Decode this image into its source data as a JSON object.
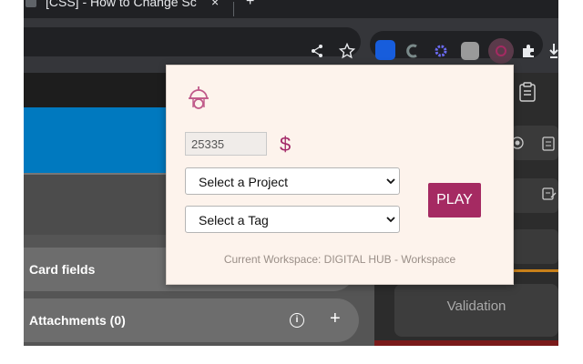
{
  "browser": {
    "tab_title": "[CSS] - How to Change Sc",
    "tab_close": "×",
    "new_tab": "+"
  },
  "toolbar": {
    "share_icon": "share-icon",
    "star_icon": "star-icon",
    "extensions": [
      "bitwarden-icon",
      "extension-c-icon",
      "extension-gear-icon",
      "mastodon-icon",
      "tracker-extension-icon",
      "puzzle-icon",
      "download-icon"
    ]
  },
  "popup": {
    "amount_value": "25335",
    "currency_symbol": "$",
    "project_select": {
      "selected": "Select a Project",
      "options": [
        "Select a Project"
      ]
    },
    "tag_select": {
      "selected": "Select a Tag",
      "options": [
        "Select a Tag"
      ]
    },
    "play_label": "PLAY",
    "workspace_text": "Current Workspace: DIGITAL HUB - Workspace",
    "accent_color": "#a52a62",
    "background_color": "#fdf3ec"
  },
  "page": {
    "card_fields_label": "Card fields",
    "attachments_label": "Attachments (0)",
    "info_glyph": "i",
    "add_glyph": "+",
    "validation_label": "Validation",
    "trello_blue": "#0079bf"
  }
}
